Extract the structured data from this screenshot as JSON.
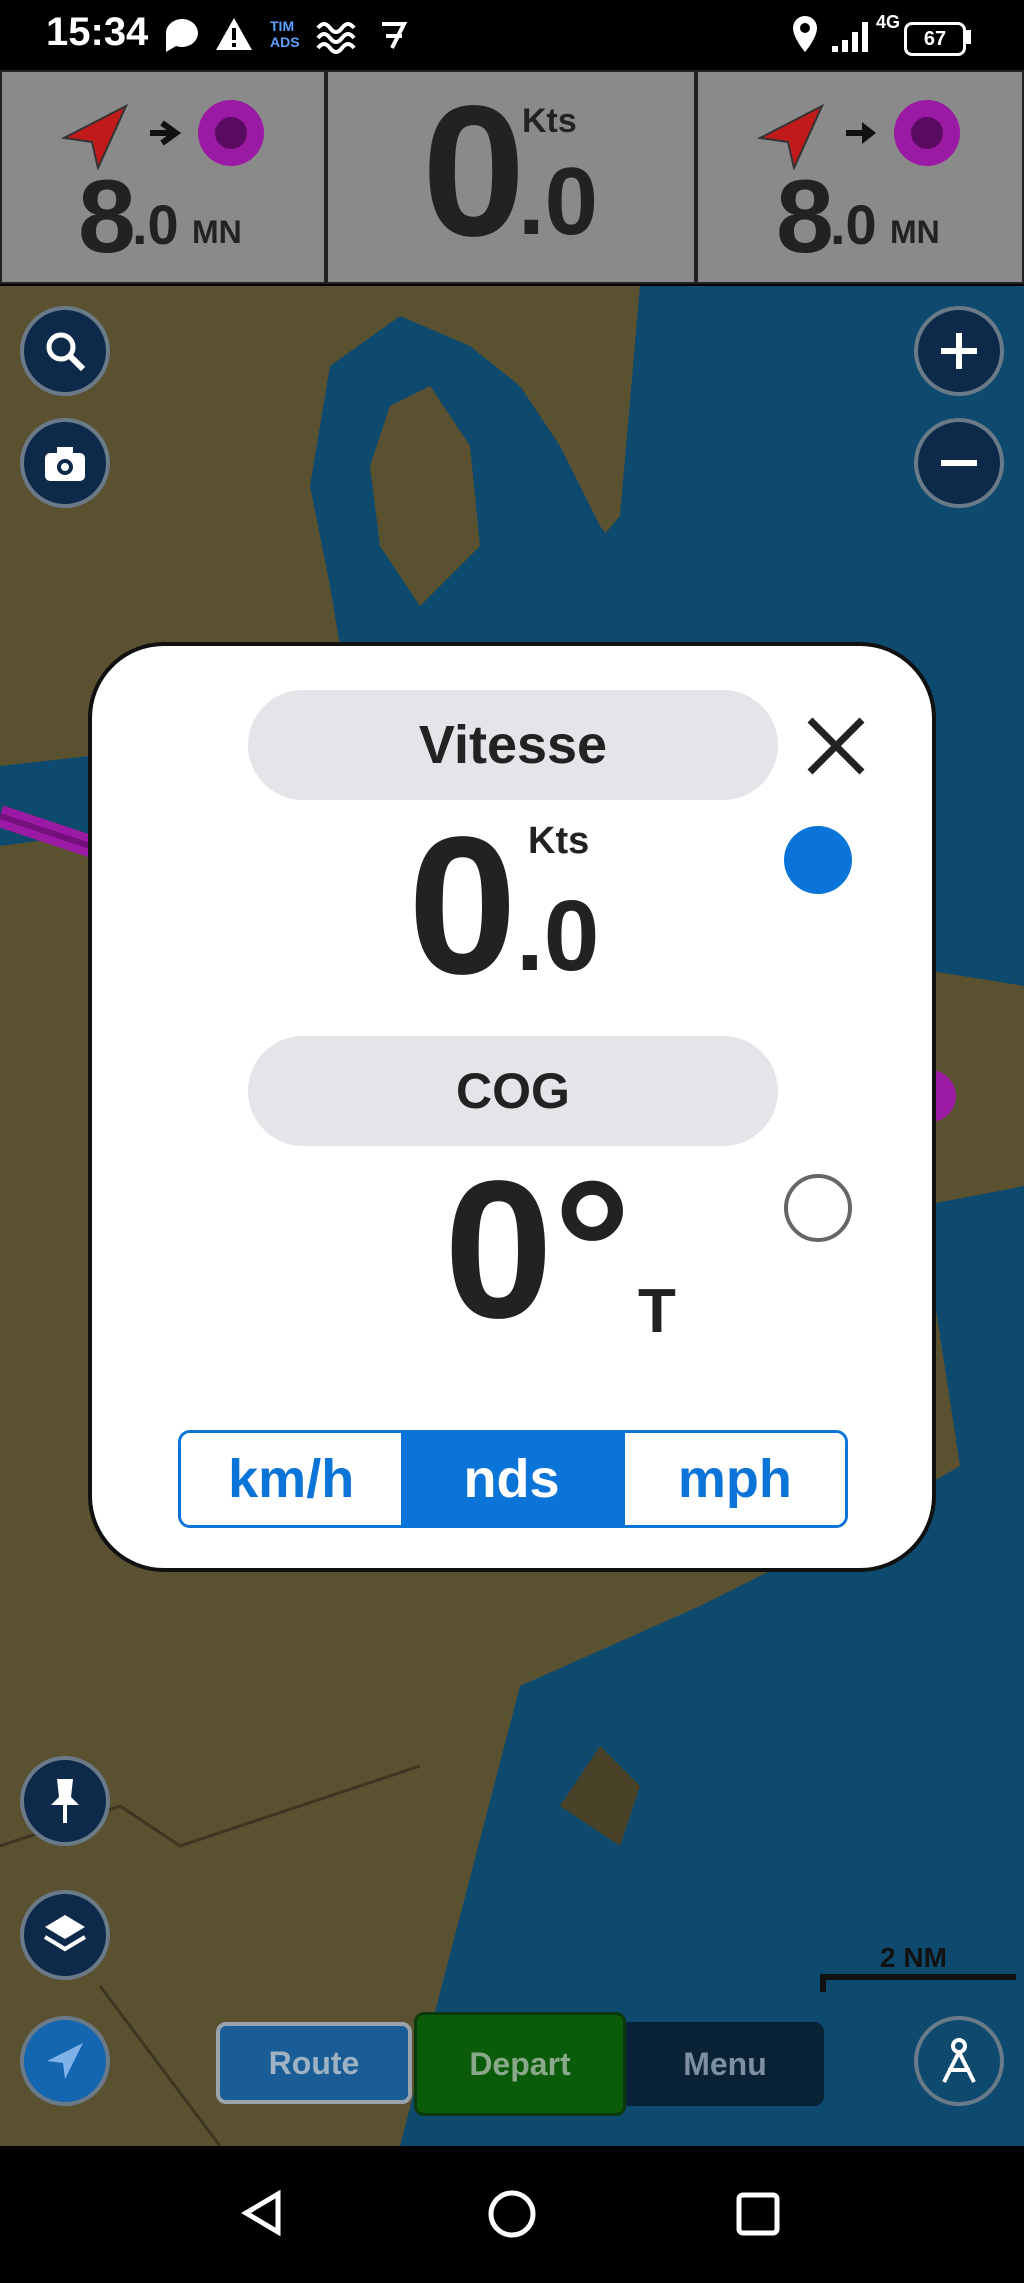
{
  "status_bar": {
    "time": "15:34",
    "carrier": [
      "TIM",
      "ADS"
    ],
    "network": "4G",
    "battery": "67"
  },
  "instruments": {
    "left": {
      "int": "8",
      "dec": ".0",
      "unit": "MN"
    },
    "center": {
      "int": "0",
      "dec": ".0",
      "unit": "Kts"
    },
    "right": {
      "int": "8",
      "dec": ".0",
      "unit": "MN"
    }
  },
  "map": {
    "scale_label": "2 NM"
  },
  "dialog": {
    "speed": {
      "title": "Vitesse",
      "int": "0",
      "dec": ".0",
      "unit": "Kts",
      "selected": true
    },
    "cog": {
      "title": "COG",
      "value": "0°",
      "ref": "T",
      "selected": false
    },
    "units": [
      {
        "label": "km/h",
        "active": false
      },
      {
        "label": "nds",
        "active": true
      },
      {
        "label": "mph",
        "active": false
      }
    ]
  },
  "toolbar": {
    "route": "Route",
    "depart": "Depart",
    "menu": "Menu"
  },
  "colors": {
    "land": "#5a5130",
    "water": "#0d4a6e",
    "accent": "#0a74d8",
    "route": "#9b1aa3",
    "depart_bg": "#0a5b0a"
  }
}
